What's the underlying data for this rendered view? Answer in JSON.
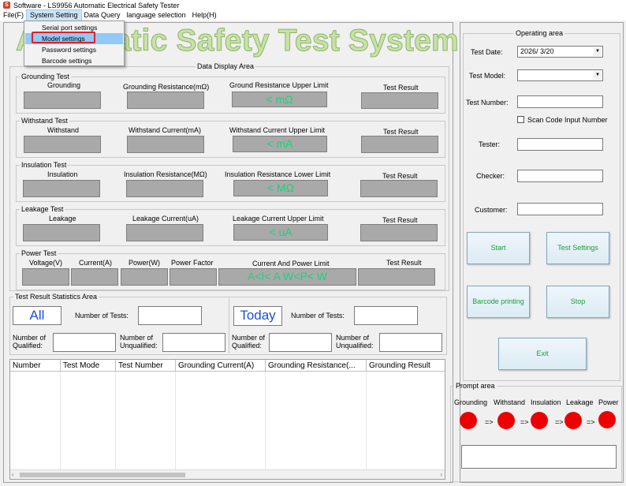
{
  "window": {
    "title": "Software - LS9956 Automatic Electrical Safety Tester"
  },
  "menu": {
    "file": "File(F)",
    "system": "System Setting",
    "data": "Data Query",
    "lang": "language selection",
    "help": "Help(H)"
  },
  "dropdown": {
    "serial": "Serial port settings",
    "model": "Model settings",
    "password": "Password settings",
    "barcode": "Barcode settings"
  },
  "app_title": "Automatic Safety Test System",
  "display_area": {
    "title": "Data Display Area"
  },
  "grounding": {
    "legend": "Grounding Test",
    "c1": "Grounding",
    "c2": "Grounding Resistance(mΩ)",
    "c3": "Ground Resistance Upper Limit",
    "c4": "Test Result",
    "limit": "< mΩ"
  },
  "withstand": {
    "legend": "Withstand Test",
    "c1": "Withstand",
    "c2": "Withstand Current(mA)",
    "c3": "Withstand Current Upper Limit",
    "c4": "Test Result",
    "limit": "<  mA"
  },
  "insulation": {
    "legend": "Insulation Test",
    "c1": "Insulation",
    "c2": "Insulation Resistance(MΩ)",
    "c3": "Insulation Resistance Lower Limit",
    "c4": "Test Result",
    "limit": "< MΩ"
  },
  "leakage": {
    "legend": "Leakage Test",
    "c1": "Leakage",
    "c2": "Leakage Current(uA)",
    "c3": "Leakage Current Upper Limit",
    "c4": "Test Result",
    "limit": "< uA"
  },
  "power": {
    "legend": "Power Test",
    "c1": "Voltage(V)",
    "c2": "Current(A)",
    "c3": "Power(W)",
    "c4": "Power Factor",
    "c5": "Current And Power Limit",
    "c6": "Test Result",
    "limit": "A<I< A W<P< W"
  },
  "stats": {
    "legend": "Test Result Statistics Area",
    "all": "All",
    "today": "Today",
    "num_tests": "Number of Tests:",
    "qualified": "Number of\nQualified:",
    "unqualified": "Number of\nUnqualified:"
  },
  "grid": {
    "columns": [
      "Number",
      "Test Mode",
      "Test Number",
      "Grounding Current(A)",
      "Grounding Resistance(...",
      "Grounding Result"
    ]
  },
  "operating": {
    "legend": "Operating area",
    "date_label": "Test Date:",
    "date_value": "2026/  3/20",
    "model_label": "Test Model:",
    "number_label": "Test Number:",
    "scan_label": "Scan Code Input Number",
    "tester_label": "Tester:",
    "checker_label": "Checker:",
    "customer_label": "Customer:",
    "start": "Start",
    "settings": "Test Settings",
    "barcode": "Barcode printing",
    "stop": "Stop",
    "exit": "Exit"
  },
  "prompt": {
    "legend": "Prompt area",
    "labels": [
      "Grounding",
      "Withstand",
      "Insulation",
      "Leakage",
      "Power"
    ],
    "arrow": "=>",
    "dot_color": "#ee0000"
  }
}
